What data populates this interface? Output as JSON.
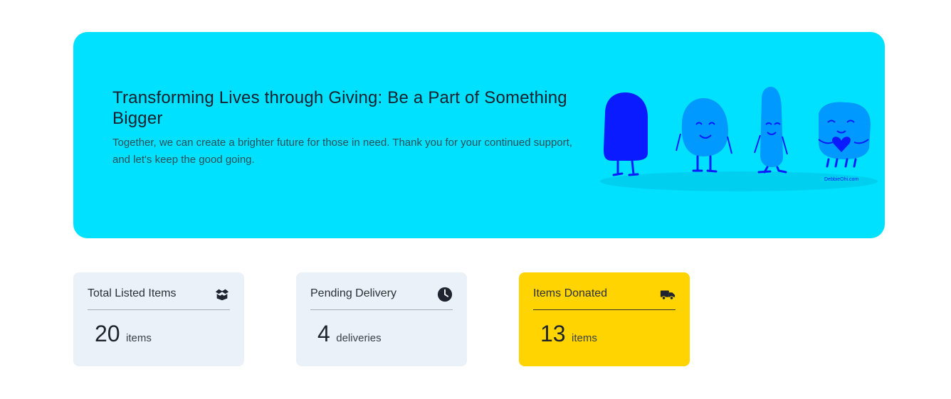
{
  "banner": {
    "title": "Transforming Lives through Giving: Be a Part of Something Bigger",
    "description": "Together, we can create a brighter future for those in need. Thank you for your continued support, and let's keep the good going.",
    "illustration_signature": "DebbieOhi.com",
    "background_color": "#00e1ff"
  },
  "stats": [
    {
      "label": "Total Listed Items",
      "value": "20",
      "unit": "items",
      "icon": "box-icon",
      "bg": "#ebf1f9"
    },
    {
      "label": "Pending Delivery",
      "value": "4",
      "unit": "deliveries",
      "icon": "clock-icon",
      "bg": "#ebf1f9"
    },
    {
      "label": "Items Donated",
      "value": "13",
      "unit": "items",
      "icon": "truck-icon",
      "bg": "#ffd400"
    }
  ]
}
